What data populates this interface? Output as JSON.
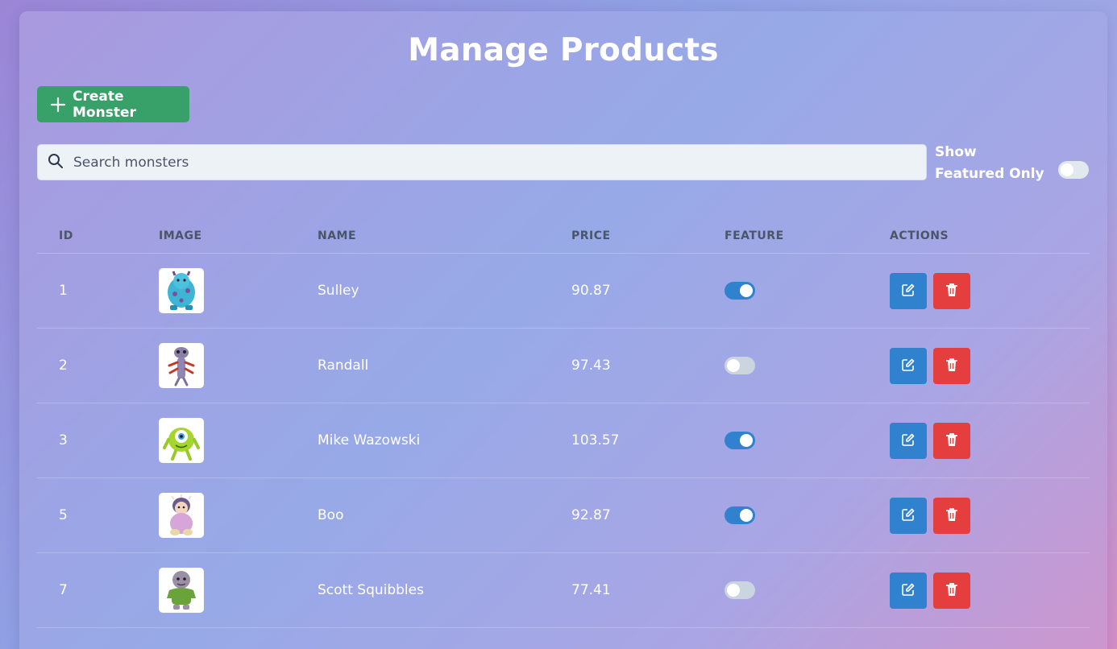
{
  "page": {
    "title": "Manage Products"
  },
  "toolbar": {
    "create_label": "Create Monster"
  },
  "search": {
    "placeholder": "Search monsters",
    "value": ""
  },
  "filter": {
    "label": "Show Featured Only",
    "enabled": false
  },
  "table": {
    "headers": [
      "ID",
      "IMAGE",
      "NAME",
      "PRICE",
      "FEATURE",
      "ACTIONS"
    ],
    "rows": [
      {
        "id": "1",
        "name": "Sulley",
        "price": "90.87",
        "featured": true,
        "image": "sulley-plush"
      },
      {
        "id": "2",
        "name": "Randall",
        "price": "97.43",
        "featured": false,
        "image": "randall-plush"
      },
      {
        "id": "3",
        "name": "Mike Wazowski",
        "price": "103.57",
        "featured": true,
        "image": "mike-plush"
      },
      {
        "id": "5",
        "name": "Boo",
        "price": "92.87",
        "featured": true,
        "image": "boo-plush"
      },
      {
        "id": "7",
        "name": "Scott Squibbles",
        "price": "77.41",
        "featured": false,
        "image": "squibbles-plush"
      }
    ]
  },
  "colors": {
    "create": "#38a169",
    "edit": "#3182ce",
    "delete": "#e53e3e",
    "toggle_on": "#3182ce",
    "toggle_off": "#cbd5e0"
  },
  "icons": {
    "create": "plus-icon",
    "search": "search-icon",
    "edit": "edit-icon",
    "delete": "trash-icon"
  }
}
